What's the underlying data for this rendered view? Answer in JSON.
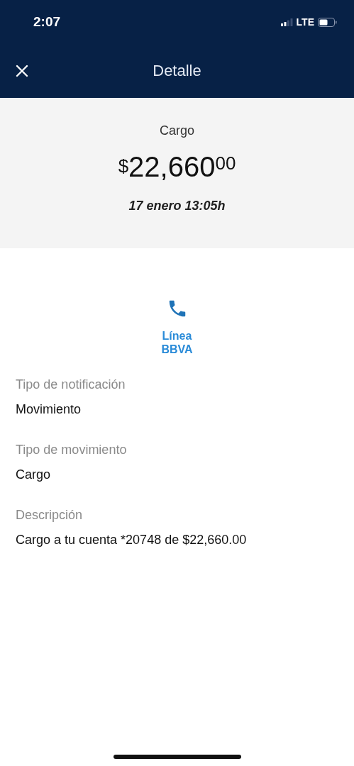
{
  "status_bar": {
    "time": "2:07",
    "network": "LTE"
  },
  "nav": {
    "title": "Detalle"
  },
  "summary": {
    "type": "Cargo",
    "amount": {
      "currency": "$",
      "whole": "22,660",
      "cents": "00"
    },
    "date": "17 enero 13:05h"
  },
  "action": {
    "label": "Línea BBVA"
  },
  "fields": [
    {
      "label": "Tipo de notificación",
      "value": "Movimiento"
    },
    {
      "label": "Tipo de movimiento",
      "value": "Cargo"
    },
    {
      "label": "Descripción",
      "value": "Cargo a tu cuenta *20748 de $22,660.00"
    }
  ]
}
